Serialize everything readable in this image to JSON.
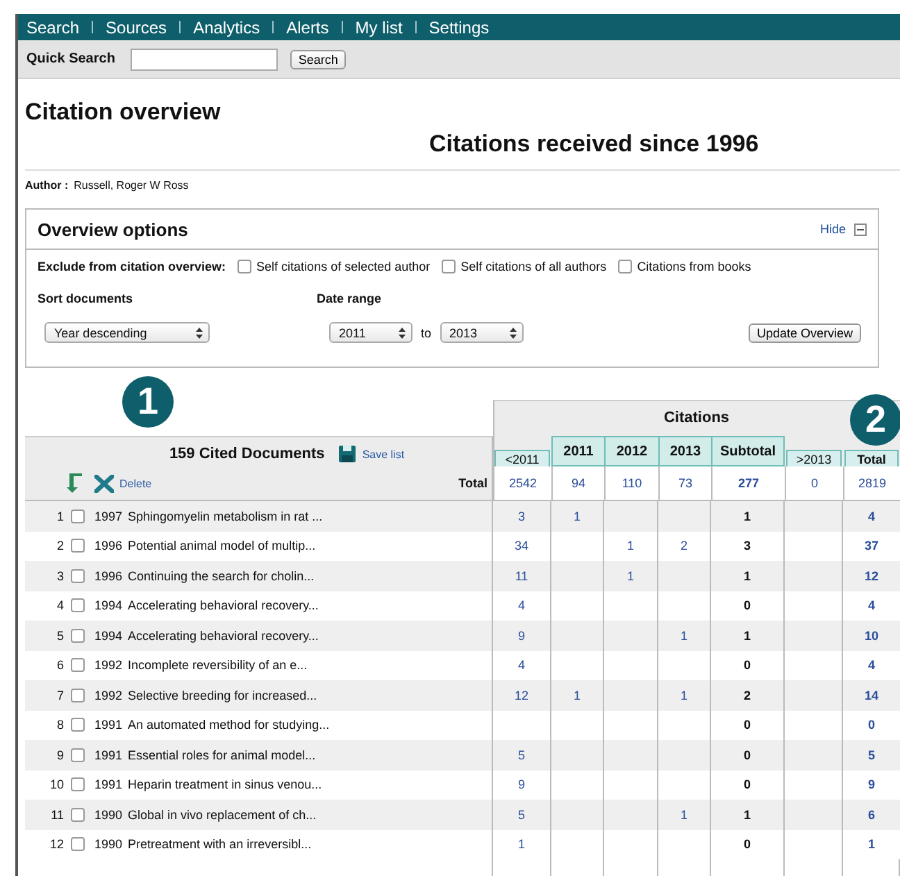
{
  "nav": [
    {
      "label": "Search"
    },
    {
      "label": "Sources"
    },
    {
      "label": "Analytics"
    },
    {
      "label": "Alerts"
    },
    {
      "label": "My list"
    },
    {
      "label": "Settings"
    }
  ],
  "quick_search": {
    "label": "Quick Search",
    "button": "Search"
  },
  "title": "Citation overview",
  "subtitle": "Citations received since 1996",
  "author": {
    "label": "Author :",
    "value": "Russell, Roger W Ross"
  },
  "options": {
    "title": "Overview options",
    "hide": "Hide",
    "exclude_label": "Exclude from citation overview:",
    "excludes": [
      {
        "label": "Self citations of selected author",
        "checked": false
      },
      {
        "label": "Self citations of all authors",
        "checked": false
      },
      {
        "label": "Citations from books",
        "checked": false
      }
    ],
    "sort_label": "Sort documents",
    "sort_value": "Year descending",
    "date_label": "Date range",
    "from": "2011",
    "to_word": "to",
    "to": "2013",
    "update": "Update Overview"
  },
  "markers": [
    "1",
    "2"
  ],
  "table": {
    "count": "159 Cited Documents",
    "save": "Save list",
    "delete": "Delete",
    "total_label": "Total",
    "citations_heading": "Citations",
    "columns": [
      {
        "label": "<2011",
        "kind": "outside"
      },
      {
        "label": "2011",
        "kind": "year"
      },
      {
        "label": "2012",
        "kind": "year"
      },
      {
        "label": "2013",
        "kind": "year"
      },
      {
        "label": "Subtotal",
        "kind": "subtotal"
      },
      {
        "label": ">2013",
        "kind": "outside"
      },
      {
        "label": "Total",
        "kind": "total"
      }
    ],
    "totals": [
      "2542",
      "94",
      "110",
      "73",
      "277",
      "0",
      "2819"
    ],
    "rows": [
      {
        "index": "1",
        "checked": false,
        "year": "1997",
        "title": "Sphingomyelin metabolism in rat ...",
        "cells": [
          "3",
          "1",
          null,
          null,
          "1",
          null,
          "4"
        ]
      },
      {
        "index": "2",
        "checked": false,
        "year": "1996",
        "title": "Potential animal model of multip...",
        "cells": [
          "34",
          null,
          "1",
          "2",
          "3",
          null,
          "37"
        ]
      },
      {
        "index": "3",
        "checked": false,
        "year": "1996",
        "title": "Continuing the search for cholin...",
        "cells": [
          "11",
          null,
          "1",
          null,
          "1",
          null,
          "12"
        ]
      },
      {
        "index": "4",
        "checked": false,
        "year": "1994",
        "title": "Accelerating behavioral recovery...",
        "cells": [
          "4",
          null,
          null,
          null,
          "0",
          null,
          "4"
        ]
      },
      {
        "index": "5",
        "checked": false,
        "year": "1994",
        "title": "Accelerating behavioral recovery...",
        "cells": [
          "9",
          null,
          null,
          "1",
          "1",
          null,
          "10"
        ]
      },
      {
        "index": "6",
        "checked": false,
        "year": "1992",
        "title": "Incomplete reversibility of an e...",
        "cells": [
          "4",
          null,
          null,
          null,
          "0",
          null,
          "4"
        ]
      },
      {
        "index": "7",
        "checked": false,
        "year": "1992",
        "title": "Selective breeding for increased...",
        "cells": [
          "12",
          "1",
          null,
          "1",
          "2",
          null,
          "14"
        ]
      },
      {
        "index": "8",
        "checked": false,
        "year": "1991",
        "title": "An automated method for studying...",
        "cells": [
          null,
          null,
          null,
          null,
          "0",
          null,
          "0"
        ]
      },
      {
        "index": "9",
        "checked": false,
        "year": "1991",
        "title": "Essential roles for animal model...",
        "cells": [
          "5",
          null,
          null,
          null,
          "0",
          null,
          "5"
        ]
      },
      {
        "index": "10",
        "checked": false,
        "year": "1991",
        "title": "Heparin treatment in sinus venou...",
        "cells": [
          "9",
          null,
          null,
          null,
          "0",
          null,
          "9"
        ]
      },
      {
        "index": "11",
        "checked": false,
        "year": "1990",
        "title": "Global in vivo replacement of ch...",
        "cells": [
          "5",
          null,
          null,
          "1",
          "1",
          null,
          "6"
        ]
      },
      {
        "index": "12",
        "checked": false,
        "year": "1990",
        "title": "Pretreatment with an irreversibl...",
        "cells": [
          "1",
          null,
          null,
          null,
          "0",
          null,
          "1"
        ]
      }
    ]
  }
}
